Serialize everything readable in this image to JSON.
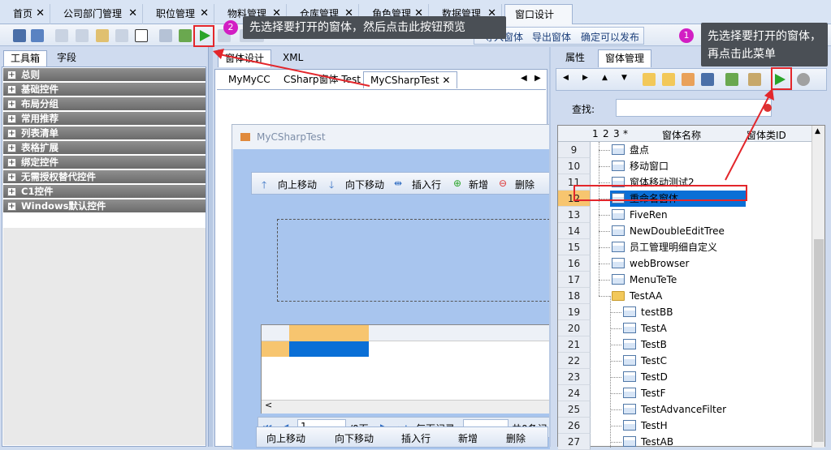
{
  "top_tabs": [
    {
      "label": "首页"
    },
    {
      "label": "公司部门管理"
    },
    {
      "label": "职位管理"
    },
    {
      "label": "物料管理"
    },
    {
      "label": "仓库管理"
    },
    {
      "label": "角色管理"
    },
    {
      "label": "数据管理"
    },
    {
      "label": "窗口设计"
    }
  ],
  "close_glyph": "✕",
  "toolbar": {
    "import_form": "导入窗体",
    "export_form": "导出窗体",
    "confirm_publish": "确定可以发布"
  },
  "left_panel": {
    "tabs": [
      "工具箱",
      "字段"
    ],
    "categories": [
      "总则",
      "基础控件",
      "布局分组",
      "常用推荐",
      "列表清单",
      "表格扩展",
      "绑定控件",
      "无需授权替代控件",
      "C1控件",
      "Windows默认控件"
    ]
  },
  "middle_panel": {
    "tabs": [
      "窗体设计",
      "XML"
    ],
    "doc_tabs": [
      "MyMyCC",
      "CSharp窗体 Test",
      "MyCSharpTest"
    ],
    "form_title": "MyCSharpTest",
    "form_toolbar": [
      "向上移动",
      "向下移动",
      "插入行",
      "新增",
      "删除"
    ],
    "pager": {
      "page_value": "1",
      "page_total": "/0页",
      "per_page": "每页记录",
      "total": "共0条记"
    }
  },
  "right_panel": {
    "tabs": [
      "属性",
      "窗体管理"
    ],
    "search_label": "查找:",
    "tree_headers": {
      "levels": [
        "1",
        "2",
        "3",
        "*"
      ],
      "name": "窗体名称",
      "id": "窗体类ID"
    },
    "rows": [
      {
        "n": "9",
        "label": "盘点",
        "indent": 1,
        "folder": false
      },
      {
        "n": "10",
        "label": "移动窗口",
        "indent": 1,
        "folder": false
      },
      {
        "n": "11",
        "label": "窗体移动测试2",
        "indent": 1,
        "folder": false
      },
      {
        "n": "12",
        "label": "重命名窗体",
        "indent": 1,
        "folder": false,
        "selected": true
      },
      {
        "n": "13",
        "label": "FiveRen",
        "indent": 1,
        "folder": false
      },
      {
        "n": "14",
        "label": "NewDoubleEditTree",
        "indent": 1,
        "folder": false
      },
      {
        "n": "15",
        "label": "员工管理明细自定义",
        "indent": 1,
        "folder": false
      },
      {
        "n": "16",
        "label": "webBrowser",
        "indent": 1,
        "folder": false
      },
      {
        "n": "17",
        "label": "MenuTeTe",
        "indent": 1,
        "folder": false
      },
      {
        "n": "18",
        "label": "TestAA",
        "indent": 1,
        "folder": true
      },
      {
        "n": "19",
        "label": "testBB",
        "indent": 2,
        "folder": false
      },
      {
        "n": "20",
        "label": "TestA",
        "indent": 2,
        "folder": false
      },
      {
        "n": "21",
        "label": "TestB",
        "indent": 2,
        "folder": false
      },
      {
        "n": "22",
        "label": "TestC",
        "indent": 2,
        "folder": false
      },
      {
        "n": "23",
        "label": "TestD",
        "indent": 2,
        "folder": false
      },
      {
        "n": "24",
        "label": "TestF",
        "indent": 2,
        "folder": false
      },
      {
        "n": "25",
        "label": "TestAdvanceFilter",
        "indent": 2,
        "folder": false
      },
      {
        "n": "26",
        "label": "TestH",
        "indent": 2,
        "folder": false
      },
      {
        "n": "27",
        "label": "TestAB",
        "indent": 2,
        "folder": false
      }
    ]
  },
  "annotations": {
    "badge1": "1",
    "tip1": "先选择要打开的窗体，再点击此菜单",
    "badge2": "2",
    "tip2": "先选择要打开的窗体，然后点击此按钮预览"
  },
  "colors": {
    "accent_red": "#e3262b",
    "badge_magenta": "#d21ec3",
    "play_green": "#2aa52a",
    "selection_blue": "#0a6fd6"
  }
}
